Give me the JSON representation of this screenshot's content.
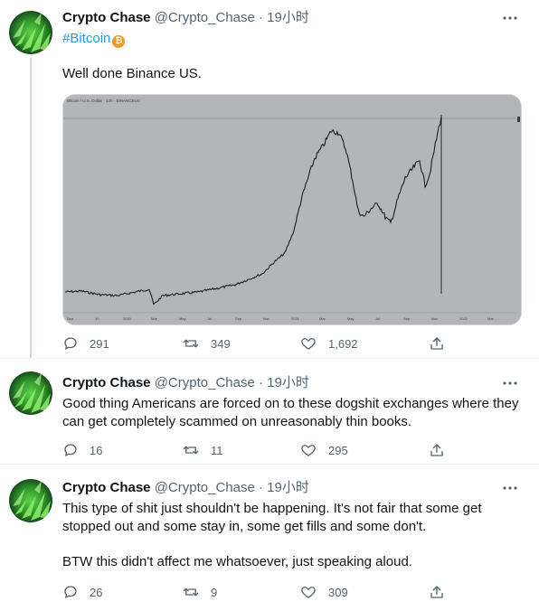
{
  "tweets": [
    {
      "name": "Crypto Chase",
      "handle": "@Crypto_Chase",
      "dot": "·",
      "time": "19小时",
      "hashtag": "#Bitcoin",
      "btc_symbol": "₿",
      "text": "Well done Binance US.",
      "chart_header": "Bitcoin / U.S. Dollar · 12h · BINANCEUS",
      "chart_ticks": [
        "Sep",
        "10",
        "2020",
        "Mar",
        "May",
        "Jul",
        "Sep",
        "Nov",
        "2021",
        "Mar",
        "May",
        "Jul",
        "Sep",
        "Nov",
        "2022",
        "Mar"
      ],
      "replies": "291",
      "retweets": "349",
      "likes": "1,692"
    },
    {
      "name": "Crypto Chase",
      "handle": "@Crypto_Chase",
      "dot": "·",
      "time": "19小时",
      "text": "Good thing Americans are forced on to these dogshit exchanges where they can get completely scammed on unreasonably thin books.",
      "replies": "16",
      "retweets": "11",
      "likes": "295"
    },
    {
      "name": "Crypto Chase",
      "handle": "@Crypto_Chase",
      "dot": "·",
      "time": "19小时",
      "text": "This type of shit just shouldn't be happening. It's not fair that some get stopped out and some stay in, some get fills and some don't.",
      "text2": "BTW this didn't affect me whatsoever, just speaking aloud.",
      "replies": "26",
      "retweets": "9",
      "likes": "309"
    }
  ],
  "icons": [
    "reply-icon",
    "retweet-icon",
    "like-icon",
    "share-icon",
    "more-icon",
    "bitcoin-icon"
  ],
  "colors": {
    "link": "#1d9bf0",
    "muted": "#536471",
    "chart_bg": "#b3b5b9"
  }
}
